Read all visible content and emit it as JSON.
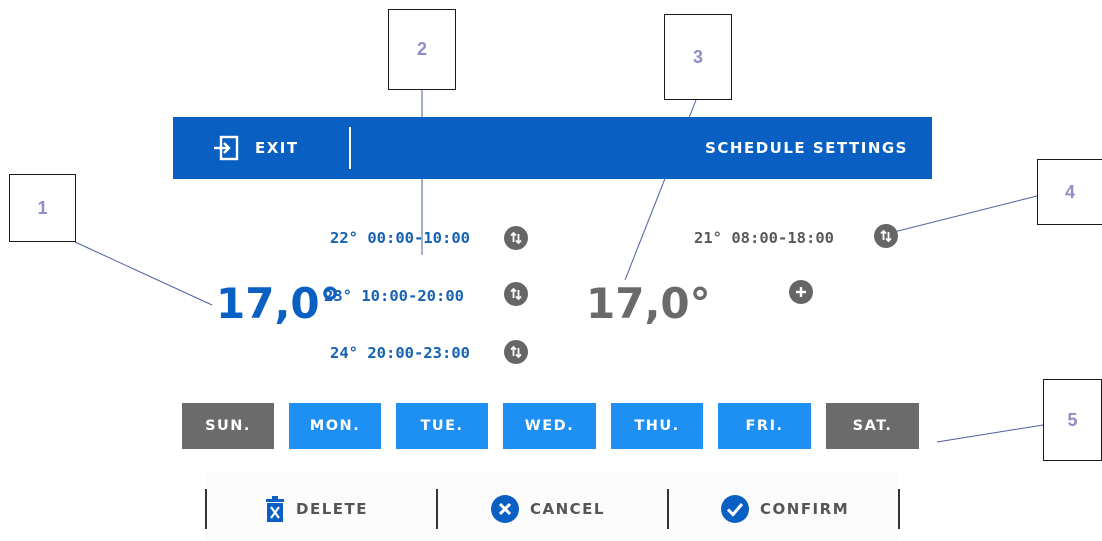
{
  "header": {
    "exit_label": "EXIT",
    "title": "SCHEDULE SETTINGS"
  },
  "left_schedule": {
    "current_temp": "17,0°",
    "periods": [
      {
        "text": "22° 00:00-10:00"
      },
      {
        "text": "23° 10:00-20:00"
      },
      {
        "text": "24° 20:00-23:00"
      }
    ]
  },
  "right_schedule": {
    "current_temp": "17,0°",
    "periods": [
      {
        "text": "21° 08:00-18:00"
      }
    ]
  },
  "days": [
    {
      "label": "SUN.",
      "active": false
    },
    {
      "label": "MON.",
      "active": true
    },
    {
      "label": "TUE.",
      "active": true
    },
    {
      "label": "WED.",
      "active": true
    },
    {
      "label": "THU.",
      "active": true
    },
    {
      "label": "FRI.",
      "active": true
    },
    {
      "label": "SAT.",
      "active": false
    }
  ],
  "actions": {
    "delete_label": "DELETE",
    "cancel_label": "CANCEL",
    "confirm_label": "CONFIRM"
  },
  "callouts": [
    "1",
    "2",
    "3",
    "4",
    "5"
  ],
  "colors": {
    "header_blue": "#0a5fc3",
    "active_day": "#1e8ff3",
    "inactive_day": "#6b6b6b",
    "text_blue": "#1561b3",
    "callout_text": "#8e8ec6"
  }
}
